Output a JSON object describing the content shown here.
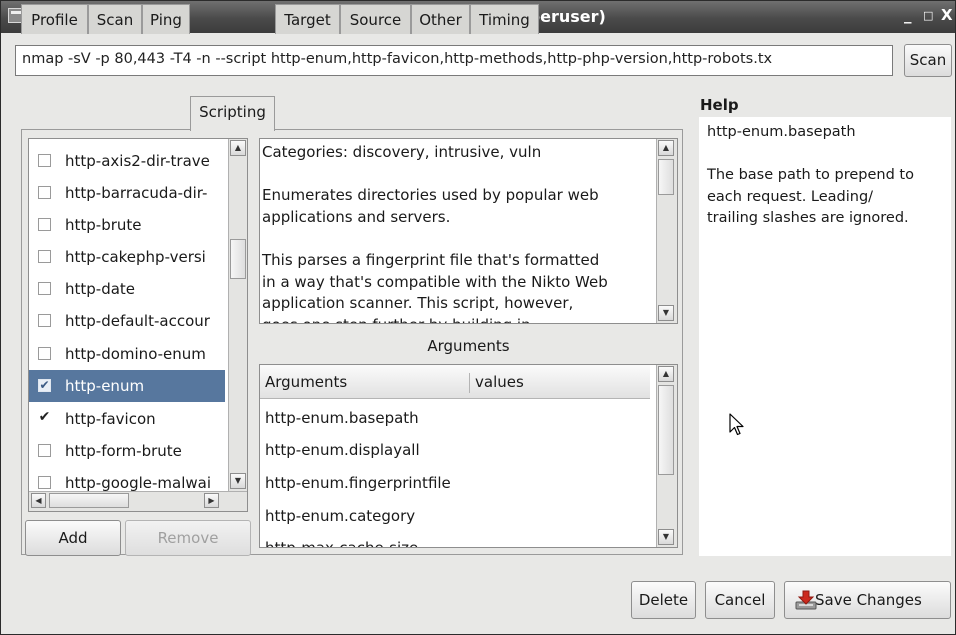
{
  "window": {
    "title": "Profile Editor (as superuser)",
    "controls": [
      "_",
      "□",
      "X"
    ]
  },
  "command": {
    "value": "nmap -sV -p 80,443 -T4 -n --script http-enum,http-favicon,http-methods,http-php-version,http-robots.tx",
    "scan_label": "Scan"
  },
  "tabs": [
    {
      "label": "Profile",
      "active": false
    },
    {
      "label": "Scan",
      "active": false
    },
    {
      "label": "Ping",
      "active": false
    },
    {
      "label": "Scripting",
      "active": true
    },
    {
      "label": "Target",
      "active": false
    },
    {
      "label": "Source",
      "active": false
    },
    {
      "label": "Other",
      "active": false
    },
    {
      "label": "Timing",
      "active": false
    }
  ],
  "scripts": [
    {
      "name": "http-axis2-dir-trave",
      "checked": false,
      "selected": false
    },
    {
      "name": "http-barracuda-dir-",
      "checked": false,
      "selected": false
    },
    {
      "name": "http-brute",
      "checked": false,
      "selected": false
    },
    {
      "name": "http-cakephp-versi",
      "checked": false,
      "selected": false
    },
    {
      "name": "http-date",
      "checked": false,
      "selected": false
    },
    {
      "name": "http-default-accour",
      "checked": false,
      "selected": false
    },
    {
      "name": "http-domino-enum",
      "checked": false,
      "selected": false
    },
    {
      "name": "http-enum",
      "checked": true,
      "selected": true
    },
    {
      "name": "http-favicon",
      "checked": true,
      "selected": false
    },
    {
      "name": "http-form-brute",
      "checked": false,
      "selected": false
    },
    {
      "name": "http-google-malwai",
      "checked": false,
      "selected": false
    }
  ],
  "script_buttons": {
    "add_label": "Add",
    "remove_label": "Remove"
  },
  "description": {
    "text": "Categories: discovery, intrusive, vuln\n\nEnumerates directories used by popular web\napplications and servers.\n\nThis parses a fingerprint file that's formatted\nin a way that's compatible with the Nikto Web\napplication scanner. This script, however,\ngoes one step further by building in"
  },
  "arguments": {
    "section_label": "Arguments",
    "column_arguments": "Arguments",
    "column_values": "values",
    "rows": [
      "http-enum.basepath",
      "http-enum.displayall",
      "http-enum.fingerprintfile",
      "http-enum.category",
      "http-max-cache-size"
    ]
  },
  "help": {
    "title": "Help",
    "text": "http-enum.basepath\n\nThe base path to prepend to\neach request. Leading/\ntrailing slashes are ignored."
  },
  "footer": {
    "delete_label": "Delete",
    "cancel_label": "Cancel",
    "save_label": "Save Changes"
  },
  "icons": {
    "window_menu": "window-menu-icon",
    "minimize": "minimize-icon",
    "maximize": "maximize-icon",
    "close": "close-icon",
    "save": "save-download-icon",
    "cursor": "mouse-pointer-icon"
  },
  "colors": {
    "titlebar": "#4a4a4a",
    "selection": "#57779e",
    "save_icon": "#cc2a1e"
  }
}
